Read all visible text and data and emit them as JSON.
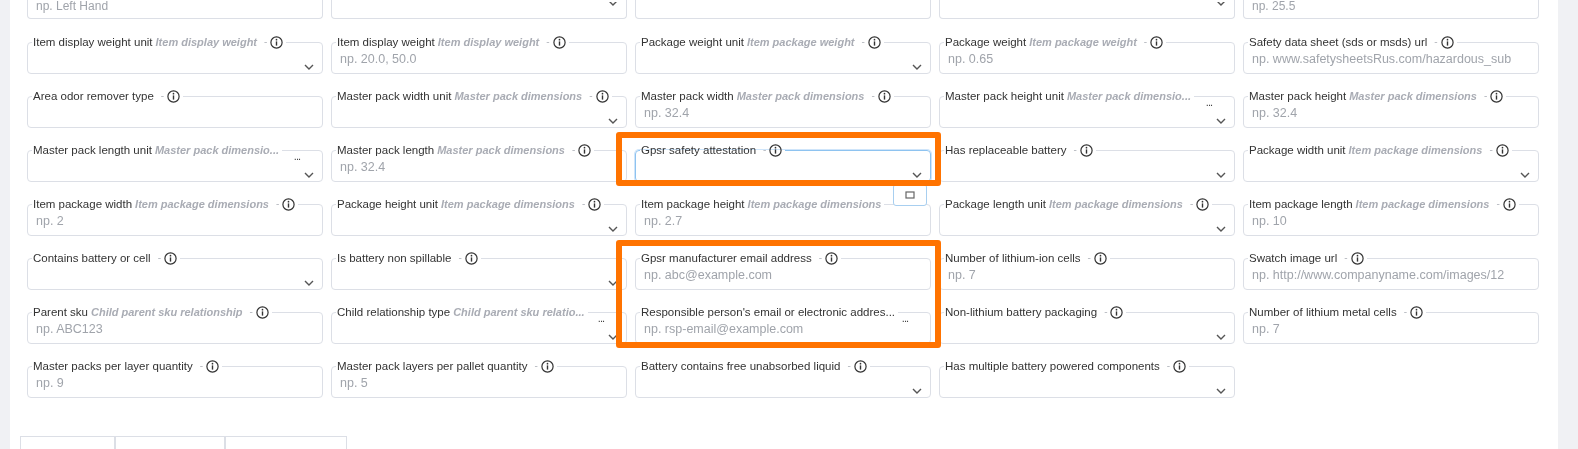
{
  "partial_row": [
    {
      "kind": "text",
      "placeholder": "np. Left Hand"
    },
    {
      "kind": "select"
    },
    {
      "kind": "text"
    },
    {
      "kind": "select"
    },
    {
      "kind": "text",
      "placeholder": "np. 25.5"
    }
  ],
  "rows": [
    {
      "fields": [
        {
          "kind": "select",
          "label": "Item display weight unit",
          "group": "Item display weight",
          "separator": "-",
          "focused": false,
          "highlighted": false
        },
        {
          "kind": "text",
          "label": "Item display weight",
          "group": "Item display weight",
          "separator": "-",
          "placeholder": "np. 20.0, 50.0",
          "focused": false,
          "highlighted": false
        },
        {
          "kind": "select",
          "label": "Package weight unit",
          "group": "Item package weight",
          "separator": "-",
          "focused": false,
          "highlighted": false
        },
        {
          "kind": "text",
          "label": "Package weight",
          "group": "Item package weight",
          "separator": "-",
          "placeholder": "np. 0.65",
          "focused": false,
          "highlighted": false
        },
        {
          "kind": "text",
          "label": "Safety data sheet (sds or msds) url",
          "separator": "-",
          "placeholder": "np. www.safetysheetsRus.com/hazardous_sub",
          "focused": false,
          "highlighted": false
        }
      ]
    },
    {
      "fields": [
        {
          "kind": "text",
          "label": "Area odor remover type",
          "separator": "-",
          "focused": false,
          "highlighted": false
        },
        {
          "kind": "select",
          "label": "Master pack width unit",
          "group": "Master pack dimensions",
          "separator": "-",
          "focused": false,
          "highlighted": false
        },
        {
          "kind": "text",
          "label": "Master pack width",
          "group": "Master pack dimensions",
          "separator": "-",
          "placeholder": "np. 32.4",
          "focused": false,
          "highlighted": false
        },
        {
          "kind": "select",
          "label": "Master pack height unit",
          "group": "Master pack dimensio...",
          "more": "...",
          "focused": false,
          "highlighted": false
        },
        {
          "kind": "text",
          "label": "Master pack height",
          "group": "Master pack dimensions",
          "separator": "-",
          "placeholder": "np. 32.4",
          "focused": false,
          "highlighted": false
        }
      ]
    },
    {
      "fields": [
        {
          "kind": "select",
          "label": "Master pack length unit",
          "group": "Master pack dimensio...",
          "more": "...",
          "focused": false,
          "highlighted": false
        },
        {
          "kind": "text",
          "label": "Master pack length",
          "group": "Master pack dimensions",
          "separator": "-",
          "placeholder": "np. 32.4",
          "focused": false,
          "highlighted": false
        },
        {
          "kind": "select",
          "label": "Gpsr safety attestation",
          "separator": "-",
          "focused": true,
          "highlighted": true
        },
        {
          "kind": "select",
          "label": "Has replaceable battery",
          "separator": "-",
          "focused": false,
          "highlighted": false
        },
        {
          "kind": "select",
          "label": "Package width unit",
          "group": "Item package dimensions",
          "separator": "-",
          "focused": false,
          "highlighted": false
        }
      ]
    },
    {
      "fields": [
        {
          "kind": "text",
          "label": "Item package width",
          "group": "Item package dimensions",
          "separator": "-",
          "placeholder": "np. 2",
          "focused": false,
          "highlighted": false
        },
        {
          "kind": "select",
          "label": "Package height unit",
          "group": "Item package dimensions",
          "separator": "-",
          "focused": false,
          "highlighted": false
        },
        {
          "kind": "text",
          "label": "Item package height",
          "group": "Item package dimensions",
          "placeholder": "np. 2.7",
          "focused": false,
          "highlighted": false
        },
        {
          "kind": "select",
          "label": "Package length unit",
          "group": "Item package dimensions",
          "separator": "-",
          "focused": false,
          "highlighted": false
        },
        {
          "kind": "text",
          "label": "Item package length",
          "group": "Item package dimensions",
          "separator": "-",
          "placeholder": "np. 10",
          "focused": false,
          "highlighted": false
        }
      ]
    },
    {
      "fields": [
        {
          "kind": "select",
          "label": "Contains battery or cell",
          "separator": "-",
          "focused": false,
          "highlighted": false
        },
        {
          "kind": "select",
          "label": "Is battery non spillable",
          "separator": "-",
          "focused": false,
          "highlighted": false
        },
        {
          "kind": "text",
          "label": "Gpsr manufacturer email address",
          "separator": "-",
          "placeholder": "np. abc@example.com",
          "focused": false,
          "highlighted": true
        },
        {
          "kind": "text",
          "label": "Number of lithium-ion cells",
          "separator": "-",
          "placeholder": "np. 7",
          "focused": false,
          "highlighted": false
        },
        {
          "kind": "text",
          "label": "Swatch image url",
          "separator": "-",
          "placeholder": "np. http://www.companyname.com/images/12",
          "focused": false,
          "highlighted": false
        }
      ]
    },
    {
      "fields": [
        {
          "kind": "text",
          "label": "Parent sku",
          "group": "Child parent sku relationship",
          "separator": "-",
          "placeholder": "np. ABC123",
          "focused": false,
          "highlighted": false
        },
        {
          "kind": "select",
          "label": "Child relationship type",
          "group": "Child parent sku relatio...",
          "more": "...",
          "focused": false,
          "highlighted": false
        },
        {
          "kind": "text",
          "label": "Responsible person's email or electronic addres...",
          "more": "...",
          "placeholder": "np. rsp-email@example.com",
          "focused": false,
          "highlighted": true
        },
        {
          "kind": "select",
          "label": "Non-lithium battery packaging",
          "separator": "-",
          "focused": false,
          "highlighted": false
        },
        {
          "kind": "text",
          "label": "Number of lithium metal cells",
          "separator": "-",
          "placeholder": "np. 7",
          "focused": false,
          "highlighted": false
        }
      ]
    },
    {
      "fields": [
        {
          "kind": "text",
          "label": "Master packs per layer quantity",
          "separator": "-",
          "placeholder": "np. 9",
          "focused": false,
          "highlighted": false
        },
        {
          "kind": "text",
          "label": "Master pack layers per pallet quantity",
          "separator": "-",
          "placeholder": "np. 5",
          "focused": false,
          "highlighted": false
        },
        {
          "kind": "select",
          "label": "Battery contains free unabsorbed liquid",
          "separator": "-",
          "focused": false,
          "highlighted": false
        },
        {
          "kind": "select",
          "label": "Has multiple battery powered components",
          "separator": "-",
          "focused": false,
          "highlighted": false
        }
      ]
    }
  ]
}
